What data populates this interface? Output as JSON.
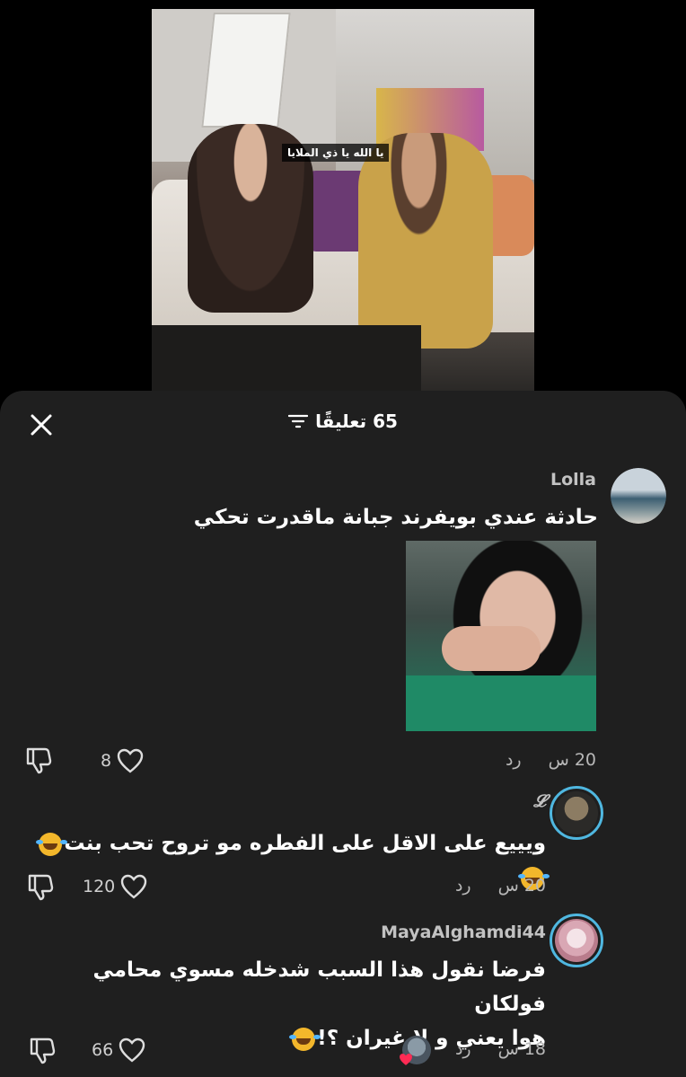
{
  "video": {
    "caption": "يا الله يا ذي الملايا"
  },
  "sheet": {
    "title": "65 تعليقًا",
    "close_icon": "close-icon",
    "filter_icon": "filter-icon"
  },
  "comments": [
    {
      "username": "Lolla",
      "text": "حادثة عندي بويفرند جبانة ماقدرت تحكي",
      "time": "20 س",
      "reply_label": "رد",
      "likes": "8",
      "has_image": true
    },
    {
      "username": "𝓛",
      "text": "ويييع على الاقل على الفطره مو تروح تحب بنت",
      "time": "20 س",
      "reply_label": "رد",
      "likes": "120"
    },
    {
      "username": "MayaAlghamdi44",
      "text_line1": "فرضا نقول هذا السبب شدخله مسوي محامي فولكان",
      "text_line2": "هوا يعني و لا غيران ؟!",
      "time": "18 س",
      "reply_label": "رد",
      "likes": "66"
    }
  ],
  "colors": {
    "sheet_bg": "#1f1f1f",
    "ring": "#4fb7e0",
    "heart_red": "#ff2b54"
  }
}
